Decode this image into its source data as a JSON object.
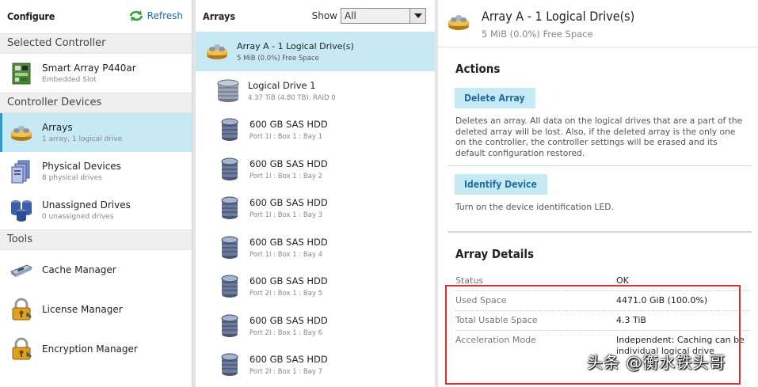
{
  "left": {
    "title": "Configure",
    "refresh_label": "Refresh",
    "sections": {
      "selected_controller": "Selected Controller",
      "controller_devices": "Controller Devices",
      "tools": "Tools"
    },
    "controller": {
      "label": "Smart Array P440ar",
      "sub": "Embedded Slot"
    },
    "devices": [
      {
        "label": "Arrays",
        "sub": "1 array, 1 logical drive"
      },
      {
        "label": "Physical Devices",
        "sub": "8 physical drives"
      },
      {
        "label": "Unassigned Drives",
        "sub": "0 unassigned drives"
      }
    ],
    "tools": [
      {
        "label": "Cache Manager"
      },
      {
        "label": "License Manager"
      },
      {
        "label": "Encryption Manager"
      }
    ]
  },
  "middle": {
    "title": "Arrays",
    "show_label": "Show",
    "show_value": "All",
    "array": {
      "label": "Array A - 1 Logical Drive(s)",
      "sub": "5 MiB (0.0%) Free Space"
    },
    "logical_drive": {
      "label": "Logical Drive 1",
      "sub": "4.37 TiB (4.80 TB), RAID 0"
    },
    "drives": [
      {
        "label": "600 GB SAS HDD",
        "sub": "Port 1I : Box 1 : Bay 1"
      },
      {
        "label": "600 GB SAS HDD",
        "sub": "Port 1I : Box 1 : Bay 2"
      },
      {
        "label": "600 GB SAS HDD",
        "sub": "Port 1I : Box 1 : Bay 3"
      },
      {
        "label": "600 GB SAS HDD",
        "sub": "Port 1I : Box 1 : Bay 4"
      },
      {
        "label": "600 GB SAS HDD",
        "sub": "Port 2I : Box 1 : Bay 5"
      },
      {
        "label": "600 GB SAS HDD",
        "sub": "Port 2I : Box 1 : Bay 6"
      },
      {
        "label": "600 GB SAS HDD",
        "sub": "Port 2I : Box 1 : Bay 7"
      }
    ]
  },
  "right": {
    "title": "Array A - 1 Logical Drive(s)",
    "subtitle": "5 MiB (0.0%) Free Space",
    "actions_title": "Actions",
    "delete_label": "Delete Array",
    "delete_desc": "Deletes an array. All data on the logical drives that are a part of the deleted array will be lost. Also, if the deleted array is the only one on the controller, the controller settings will be erased and its default configuration restored.",
    "identify_label": "Identify Device",
    "identify_desc": "Turn on the device identification LED.",
    "details_title": "Array Details",
    "details": [
      {
        "label": "Status",
        "value": "OK"
      },
      {
        "label": "Used Space",
        "value": "4471.0 GiB (100.0%)"
      },
      {
        "label": "Total Usable Space",
        "value": "4.3 TiB"
      },
      {
        "label": "Acceleration Mode",
        "value": "Independent: Caching can be"
      }
    ],
    "details_more": "individual logical drive"
  },
  "watermark": "头条 @衡水铁头哥",
  "colors": {
    "selected_bg": "#c7e9f4",
    "accent": "#2e9ad0",
    "action_text": "#1f6fa3",
    "highlight": "#e0302a"
  }
}
